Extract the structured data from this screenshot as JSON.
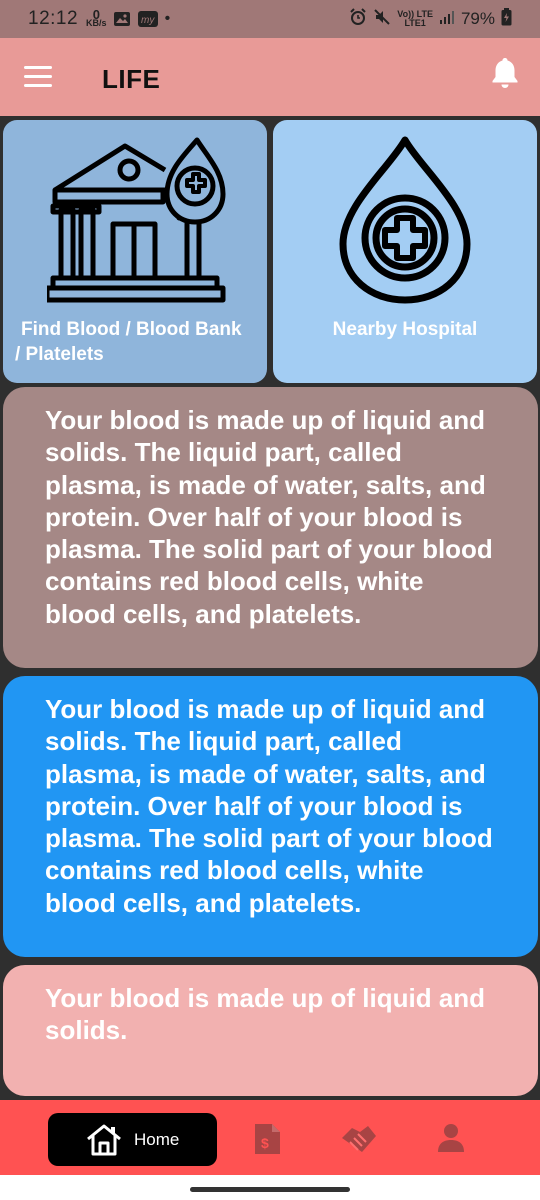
{
  "status_bar": {
    "time": "12:12",
    "net_speed_value": "0",
    "net_speed_unit": "KB/s",
    "dot": "•",
    "volte_top": "Vo)) LTE",
    "volte_bottom": "LTE1",
    "battery_percent": "79%",
    "icons": [
      "gallery-icon",
      "myntra-icon",
      "alarm-icon",
      "mute-icon",
      "signal-icon",
      "battery-icon"
    ]
  },
  "app_bar": {
    "title": "LIFE",
    "menu_icon": "hamburger-menu-icon",
    "notification_icon": "bell-icon"
  },
  "tiles": [
    {
      "label": "Find Blood / Blood Bank / Platelets",
      "icon": "blood-bank-building-icon",
      "color": "#8fb5db"
    },
    {
      "label": "Nearby Hospital",
      "icon": "blood-drop-medical-cross-icon",
      "color": "#a3cdf3"
    }
  ],
  "cards": [
    {
      "text": "Your blood is made up of liquid and solids. The liquid part, called plasma, is made of water, salts, and protein. Over half of your blood is plasma. The solid part of your blood contains red blood cells, white blood cells, and platelets.",
      "color": "#a58886"
    },
    {
      "text": "Your blood is made up of liquid and solids. The liquid part, called plasma, is made of water, salts, and protein. Over half of your blood is plasma. The solid part of your blood contains red blood cells, white blood cells, and platelets.",
      "color": "#2196f3"
    },
    {
      "text": "Your blood is made up of liquid and solids.",
      "color": "#f2b1b0"
    }
  ],
  "bottom_nav": {
    "home_label": "Home",
    "items": [
      "home-icon",
      "document-icon",
      "handshake-icon",
      "person-icon"
    ],
    "background": "#ff5252"
  }
}
